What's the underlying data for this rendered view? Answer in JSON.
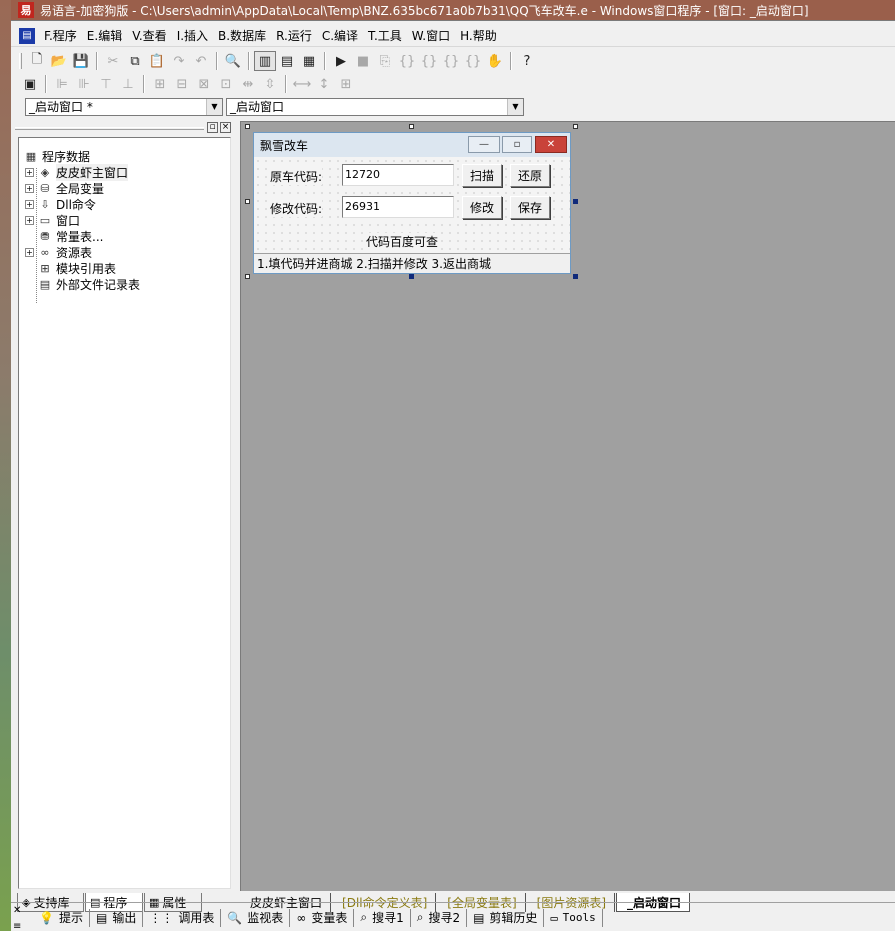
{
  "titlebar": {
    "text": "易语言-加密狗版 - C:\\Users\\admin\\AppData\\Local\\Temp\\BNZ.635bc671a0b7b31\\QQ飞车改车.e - Windows窗口程序 - [窗口: _启动窗口]"
  },
  "menu": {
    "items": [
      "F.程序",
      "E.编辑",
      "V.查看",
      "I.插入",
      "B.数据库",
      "R.运行",
      "C.编译",
      "T.工具",
      "W.窗口",
      "H.帮助"
    ]
  },
  "combos": {
    "left": "_启动窗口 *",
    "right": "_启动窗口"
  },
  "tree": {
    "root": "程序数据",
    "items": [
      "皮皮虾主窗口",
      "全局变量",
      "Dll命令",
      "窗口",
      "常量表...",
      "资源表",
      "模块引用表",
      "外部文件记录表"
    ]
  },
  "left_tabs": [
    "支持库",
    "程序",
    "属性"
  ],
  "form": {
    "title": "飘雪改车",
    "orig_label": "原车代码:",
    "orig_value": "12720",
    "mod_label": "修改代码:",
    "mod_value": "26931",
    "btn_scan": "扫描",
    "btn_restore": "还原",
    "btn_modify": "修改",
    "btn_save": "保存",
    "hint": "代码百度可查",
    "status": "1.填代码并进商城    2.扫描并修改   3.返出商城"
  },
  "bottom_tabs": [
    "皮皮虾主窗口",
    "[Dll命令定义表]",
    "[全局变量表]",
    "[图片资源表]",
    "_启动窗口"
  ],
  "bottom_bar": [
    "提示",
    "输出",
    "调用表",
    "监视表",
    "变量表",
    "搜寻1",
    "搜寻2",
    "剪辑历史",
    "Tools"
  ]
}
